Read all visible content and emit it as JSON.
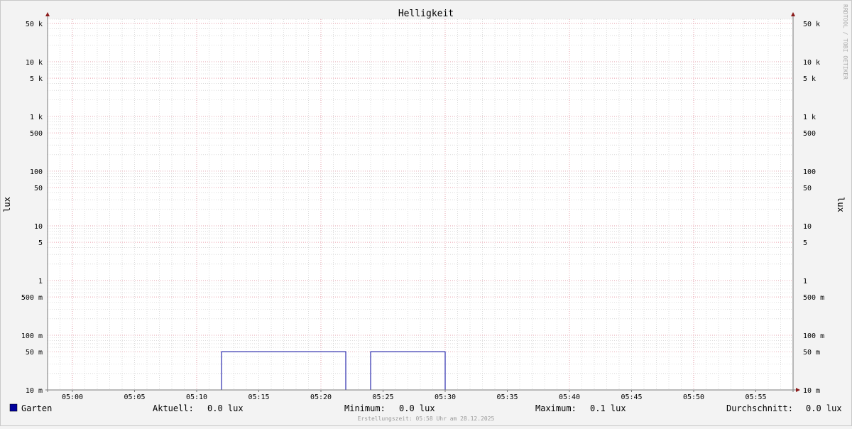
{
  "title": "Helligkeit",
  "watermark": "RRDTOOL / TOBI OETIKER",
  "footer": "Erstellungszeit: 05:58 Uhr am 28.12.2025",
  "colors": {
    "background": "#f3f3f3",
    "plot": "#ffffff",
    "major_grid": "#e88a9a",
    "minor_grid": "#c6c6c6",
    "series": "#00009c",
    "axis": "#7a7a7a",
    "arrow": "#8b1a1a"
  },
  "chart_data": {
    "type": "line",
    "title": "Helligkeit",
    "ylabel": "lux",
    "ylabel_right": "lux",
    "y_scale": "log",
    "ylim": [
      0.01,
      60000
    ],
    "y_ticks": [
      {
        "v": 50000,
        "label": "50 k"
      },
      {
        "v": 10000,
        "label": "10 k"
      },
      {
        "v": 5000,
        "label": "5 k"
      },
      {
        "v": 1000,
        "label": "1 k"
      },
      {
        "v": 500,
        "label": "500"
      },
      {
        "v": 100,
        "label": "100"
      },
      {
        "v": 50,
        "label": "50"
      },
      {
        "v": 10,
        "label": "10"
      },
      {
        "v": 5,
        "label": "5"
      },
      {
        "v": 1,
        "label": "1"
      },
      {
        "v": 0.5,
        "label": "500 m"
      },
      {
        "v": 0.1,
        "label": "100 m"
      },
      {
        "v": 0.05,
        "label": "50 m"
      },
      {
        "v": 0.01,
        "label": "10 m"
      }
    ],
    "xlim": [
      "04:58",
      "05:58"
    ],
    "x_ticks": [
      "05:00",
      "05:05",
      "05:10",
      "05:15",
      "05:20",
      "05:25",
      "05:30",
      "05:35",
      "05:40",
      "05:45",
      "05:50",
      "05:55"
    ],
    "grid": true,
    "series": [
      {
        "name": "Garten",
        "color": "#00009c",
        "points": [
          [
            "04:58",
            0.01
          ],
          [
            "05:12",
            0.01
          ],
          [
            "05:12",
            0.05
          ],
          [
            "05:22",
            0.05
          ],
          [
            "05:22",
            0.01
          ],
          [
            "05:24",
            0.01
          ],
          [
            "05:24",
            0.05
          ],
          [
            "05:30",
            0.05
          ],
          [
            "05:30",
            0.01
          ],
          [
            "05:58",
            0.01
          ]
        ]
      }
    ],
    "legend": {
      "name": "Garten",
      "stats": [
        {
          "label": "Aktuell:",
          "value": "0.0 lux"
        },
        {
          "label": "Minimum:",
          "value": "0.0 lux"
        },
        {
          "label": "Maximum:",
          "value": "0.1 lux"
        },
        {
          "label": "Durchschnitt:",
          "value": "0.0 lux"
        }
      ]
    }
  }
}
